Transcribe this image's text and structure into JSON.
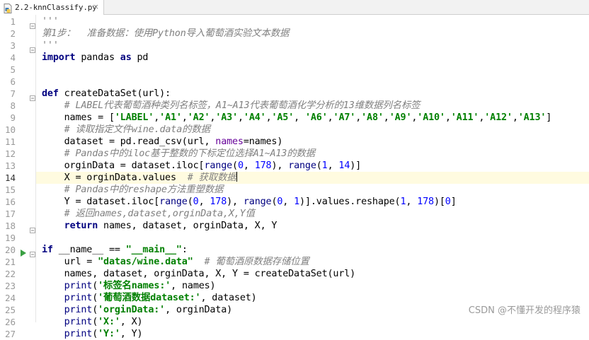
{
  "tab": {
    "filename": "2.2-knnClassify.py",
    "close": "×"
  },
  "current_line": 14,
  "lines": [
    {
      "n": "1",
      "html": "<span class=\"cm\">'''</span>"
    },
    {
      "n": "2",
      "html": "<span class=\"cm\">第1步：  准备数据：使用Python导入葡萄酒实验文本数据</span>"
    },
    {
      "n": "3",
      "html": "<span class=\"cm\">'''</span>"
    },
    {
      "n": "4",
      "html": "<span class=\"kw\">import</span> pandas <span class=\"kw\">as</span> pd"
    },
    {
      "n": "5",
      "html": ""
    },
    {
      "n": "6",
      "html": ""
    },
    {
      "n": "7",
      "html": "<span class=\"kw\">def</span> createDataSet(url):"
    },
    {
      "n": "8",
      "html": "    <span class=\"cm\"># LABEL代表葡萄酒种类列名标签，A1~A13代表葡萄酒化学分析的13维数据列名标签</span>"
    },
    {
      "n": "9",
      "html": "    names = [<span class=\"str\">'LABEL'</span>,<span class=\"str\">'A1'</span>,<span class=\"str\">'A2'</span>,<span class=\"str\">'A3'</span>,<span class=\"str\">'A4'</span>,<span class=\"str\">'A5'</span>, <span class=\"str\">'A6'</span>,<span class=\"str\">'A7'</span>,<span class=\"str\">'A8'</span>,<span class=\"str\">'A9'</span>,<span class=\"str\">'A10'</span>,<span class=\"str\">'A11'</span>,<span class=\"str\">'A12'</span>,<span class=\"str\">'A13'</span>]"
    },
    {
      "n": "10",
      "html": "    <span class=\"cm\"># 读取指定文件wine.data的数据</span>"
    },
    {
      "n": "11",
      "html": "    dataset = pd.read_csv(url, <span class=\"param\">names</span>=names)"
    },
    {
      "n": "12",
      "html": "    <span class=\"cm\"># Pandas中的iloc基于整数的下标定位选择A1~A13的数据</span>"
    },
    {
      "n": "13",
      "html": "    orginData = dataset.iloc[<span class=\"builtin\">range</span>(<span class=\"num\">0</span>, <span class=\"num\">178</span>), <span class=\"builtin\">range</span>(<span class=\"num\">1</span>, <span class=\"num\">14</span>)]"
    },
    {
      "n": "14",
      "html": "    X = orginData.values  <span class=\"cm\"># 获取数据</span><span class=\"caret\"></span>"
    },
    {
      "n": "15",
      "html": "    <span class=\"cm\"># Pandas中的reshape方法重塑数据</span>"
    },
    {
      "n": "16",
      "html": "    Y = dataset.iloc[<span class=\"builtin\">range</span>(<span class=\"num\">0</span>, <span class=\"num\">178</span>), <span class=\"builtin\">range</span>(<span class=\"num\">0</span>, <span class=\"num\">1</span>)].values.reshape(<span class=\"num\">1</span>, <span class=\"num\">178</span>)[<span class=\"num\">0</span>]"
    },
    {
      "n": "17",
      "html": "    <span class=\"cm\"># 返回names,dataset,orginData,X,Y值</span>"
    },
    {
      "n": "18",
      "html": "    <span class=\"kw\">return</span> names, dataset, orginData, X, Y"
    },
    {
      "n": "19",
      "html": ""
    },
    {
      "n": "20",
      "html": "<span class=\"kw\">if</span> __name__ == <span class=\"str\">\"__main__\"</span>:"
    },
    {
      "n": "21",
      "html": "    url = <span class=\"str\">\"datas/wine.data\"</span>  <span class=\"cm\"># 葡萄酒原数据存储位置</span>"
    },
    {
      "n": "22",
      "html": "    names, dataset, orginData, X, Y = createDataSet(url)"
    },
    {
      "n": "23",
      "html": "    <span class=\"builtin\">print</span>(<span class=\"str\">'标签名names:'</span>, names)"
    },
    {
      "n": "24",
      "html": "    <span class=\"builtin\">print</span>(<span class=\"str\">'葡萄酒数据dataset:'</span>, dataset)"
    },
    {
      "n": "25",
      "html": "    <span class=\"builtin\">print</span>(<span class=\"str\">'orginData:'</span>, orginData)"
    },
    {
      "n": "26",
      "html": "    <span class=\"builtin\">print</span>(<span class=\"str\">'X:'</span>, X)"
    },
    {
      "n": "27",
      "html": "    <span class=\"builtin\">print</span>(<span class=\"str\">'Y:'</span>, Y)"
    }
  ],
  "watermark": "CSDN @不懂开发的程序猿",
  "colors": {
    "keyword": "#000080",
    "string": "#008000",
    "number": "#0000ff",
    "comment": "#808080",
    "current_line_bg": "#fffbe0"
  },
  "icons": {
    "file": "python-file-icon",
    "run_gutter": "run-arrow-icon",
    "fold": "fold-marker-icon"
  }
}
